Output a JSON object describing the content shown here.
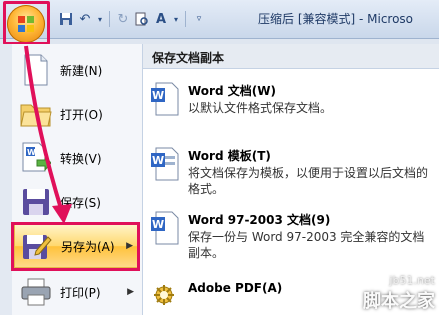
{
  "window": {
    "title": "压缩后 [兼容模式] - Microso"
  },
  "office_button": {
    "icon": "office-logo"
  },
  "qat": {
    "icons": [
      "save-icon",
      "undo-icon",
      "dropdown-icon",
      "redo-icon",
      "print-preview-icon",
      "text-format-icon",
      "customize-icon"
    ]
  },
  "menu": {
    "items": [
      {
        "label": "新建(N)",
        "icon": "new-document-icon"
      },
      {
        "label": "打开(O)",
        "icon": "open-folder-icon"
      },
      {
        "label": "转换(V)",
        "icon": "convert-icon"
      },
      {
        "label": "保存(S)",
        "icon": "save-icon"
      },
      {
        "label": "另存为(A)",
        "icon": "save-as-icon",
        "active": true
      },
      {
        "label": "打印(P)",
        "icon": "print-icon"
      }
    ]
  },
  "save_copy": {
    "header": "保存文档副本",
    "options": [
      {
        "title": "Word 文档(W)",
        "desc": "以默认文件格式保存文档。",
        "icon": "word-doc-icon"
      },
      {
        "title": "Word 模板(T)",
        "desc": "将文档保存为模板，以便用于设置以后文档的格式。",
        "icon": "word-template-icon"
      },
      {
        "title": "Word 97-2003 文档(9)",
        "desc": "保存一份与 Word 97-2003 完全兼容的文档副本。",
        "icon": "word-97-icon"
      },
      {
        "title": "Adobe PDF(A)",
        "desc": "",
        "icon": "adobe-pdf-icon"
      }
    ]
  },
  "watermark": {
    "line1": "jb51.net",
    "line2": "脚本之家"
  },
  "colors": {
    "highlight": "#e0105a",
    "active_item": "#ffd86e"
  }
}
